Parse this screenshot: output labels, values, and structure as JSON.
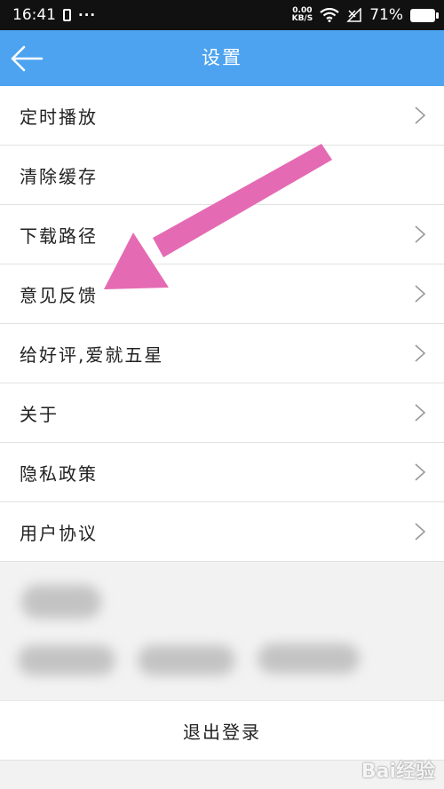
{
  "status_bar": {
    "time": "16:41",
    "dots": "···",
    "net_speed_value": "0.00",
    "net_speed_unit": "KB/S",
    "battery_percent": "71%"
  },
  "header": {
    "title": "设置",
    "back_icon": "arrow-left-icon"
  },
  "settings_items": [
    {
      "label": "定时播放",
      "has_chevron": true
    },
    {
      "label": "清除缓存",
      "has_chevron": false
    },
    {
      "label": "下载路径",
      "has_chevron": true
    },
    {
      "label": "意见反馈",
      "has_chevron": true
    },
    {
      "label": "给好评,爱就五星",
      "has_chevron": true
    },
    {
      "label": "关于",
      "has_chevron": true
    },
    {
      "label": "隐私政策",
      "has_chevron": true
    },
    {
      "label": "用户协议",
      "has_chevron": true
    }
  ],
  "logout": {
    "label": "退出登录"
  },
  "annotation": {
    "arrow_color": "#e46bb3"
  },
  "watermark": {
    "text": "Bai经验"
  },
  "colors": {
    "header_bg": "#4da3ef",
    "status_bg": "#111111",
    "page_bg": "#f2f2f2"
  }
}
